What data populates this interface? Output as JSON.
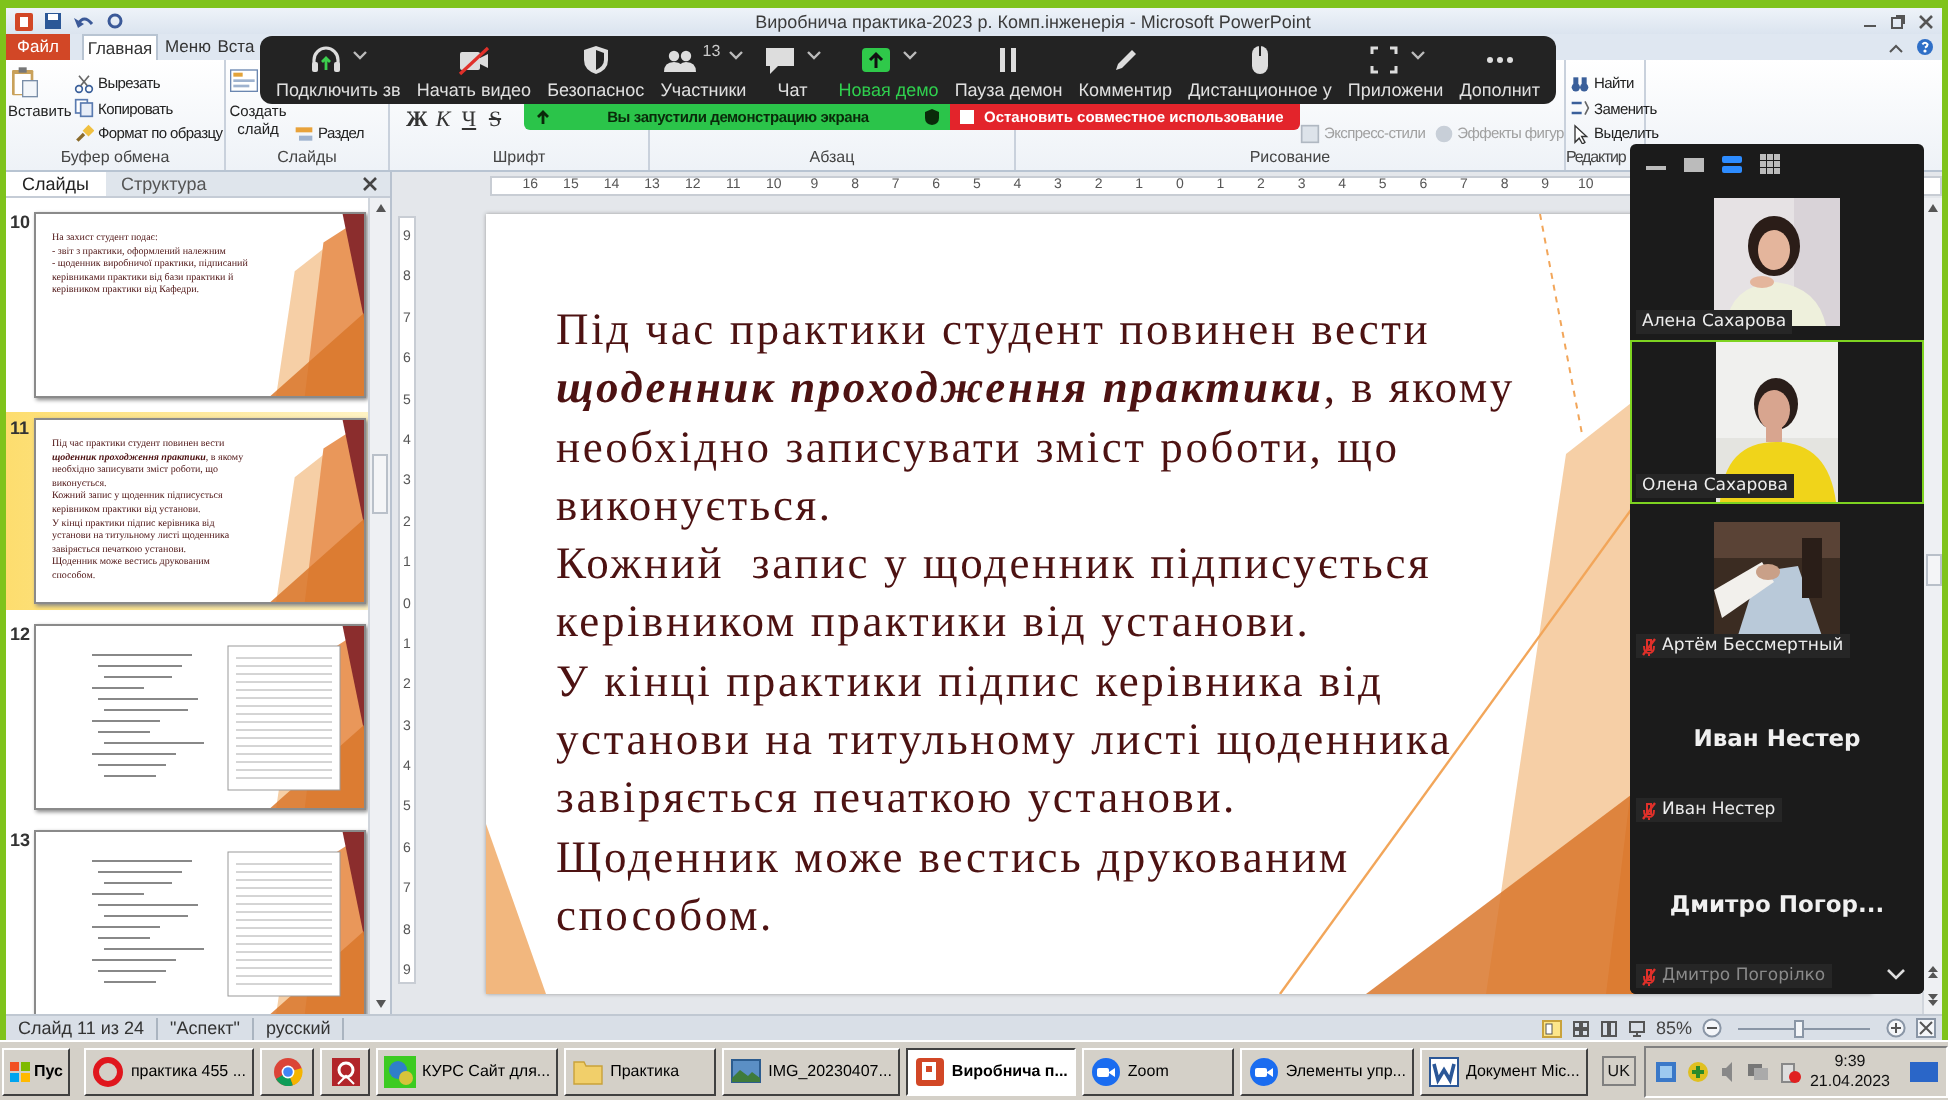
{
  "window": {
    "title": "Виробнича практика-2023 р. Комп.інженерія - Microsoft PowerPoint"
  },
  "ribbon_tabs": [
    {
      "label": "Файл",
      "kind": "file",
      "selected": false
    },
    {
      "label": "Главная",
      "kind": "tab",
      "selected": true
    },
    {
      "label": "Меню",
      "kind": "tab",
      "selected": false
    },
    {
      "label": "Вста",
      "kind": "tab",
      "selected": false
    }
  ],
  "ribbon_groups": [
    {
      "label": "Буфер обмена",
      "columns": [
        [
          {
            "label": "Вставить",
            "kind": "large",
            "disabled": false
          }
        ],
        [
          {
            "label": "Вырезать",
            "kind": "small",
            "disabled": false
          },
          {
            "label": "Копировать",
            "kind": "small",
            "disabled": false
          },
          {
            "label": "Формат по образцу",
            "kind": "small",
            "disabled": false
          }
        ]
      ]
    },
    {
      "label": "Слайды",
      "columns": [
        [
          {
            "label": "Создать слайд",
            "kind": "large",
            "disabled": false
          }
        ],
        [
          {
            "label": "Раздел",
            "kind": "small",
            "disabled": false
          }
        ]
      ]
    },
    {
      "label": "Шрифт",
      "columns": [
        [
          {
            "label": "Ж",
            "kind": "glyph",
            "disabled": false
          },
          {
            "label": "К",
            "kind": "glyph",
            "disabled": false
          },
          {
            "label": "Ч",
            "kind": "glyph",
            "disabled": false
          },
          {
            "label": "S",
            "kind": "glyph",
            "disabled": false
          }
        ]
      ]
    },
    {
      "label": "Абзац"
    },
    {
      "label": "Рисование",
      "columns": [
        [
          {
            "label": "Экспресс-стили",
            "kind": "small",
            "disabled": true
          }
        ],
        [
          {
            "label": "Эффекты фигур",
            "kind": "small",
            "disabled": true
          }
        ]
      ]
    },
    {
      "label": "Редактир",
      "columns": [
        [
          {
            "label": "Найти",
            "kind": "small",
            "disabled": false
          },
          {
            "label": "Заменить",
            "kind": "small",
            "disabled": false
          },
          {
            "label": "Выделить",
            "kind": "small",
            "disabled": false
          }
        ]
      ]
    }
  ],
  "slides_pane": {
    "tabs": [
      {
        "label": "Слайды",
        "selected": true
      },
      {
        "label": "Структура",
        "selected": false
      }
    ],
    "thumbnails": [
      {
        "number": "10",
        "kind": "text",
        "selected": false,
        "paragraphs": [
          "На захист студент подає:",
          "- звіт з практики, оформлений належним",
          "- щоденник виробничої практики, підписаний керівниками практики від бази практики й керівником практики від Кафедри."
        ]
      },
      {
        "number": "11",
        "kind": "text",
        "selected": true,
        "paragraphs": [
          "Під час практики студент повинен вести **щоденник проходження практики**, в якому необхідно записувати зміст роботи, що виконується.",
          "Кожний запис у щоденник підписується керівником практики від установи.",
          "У кінці практики підпис керівника від установи на титульному листі щоденника завіряється печаткою установи.",
          "Щоденник може вестись друкованим способом."
        ]
      },
      {
        "number": "12",
        "kind": "document",
        "selected": false
      },
      {
        "number": "13",
        "kind": "document",
        "selected": false
      }
    ]
  },
  "ruler": {
    "horizontal": [
      "16",
      "15",
      "14",
      "13",
      "12",
      "11",
      "10",
      "9",
      "8",
      "7",
      "6",
      "5",
      "4",
      "3",
      "2",
      "1",
      "0",
      "1",
      "2",
      "3",
      "4",
      "5",
      "6",
      "7",
      "8",
      "9",
      "10"
    ],
    "vertical": [
      "9",
      "8",
      "7",
      "6",
      "5",
      "4",
      "3",
      "2",
      "1",
      "0",
      "1",
      "2",
      "3",
      "4",
      "5",
      "6",
      "7",
      "8",
      "9"
    ]
  },
  "slide": {
    "paragraphs": [
      "Під час практики студент повинен вести **щоденник проходження практики**, в якому необхідно записувати зміст роботи, що виконується.",
      "Кожний  запис у щоденник підписується керівником практики від установи.",
      "У кінці практики підпис керівника від установи на титульному листі щоденника завіряється печаткою установи.",
      "Щоденник може вестись друкованим способом."
    ]
  },
  "status_bar": {
    "slide": "Слайд 11 из 24",
    "theme": "\"Аспект\"",
    "language": "русский",
    "zoom": "85%",
    "zoom_slider": {
      "level": 0.45
    }
  },
  "zoom_toolbar": {
    "items": [
      {
        "label": "Подключить зв",
        "kind": "button"
      },
      {
        "label": "Начать видео",
        "kind": "button"
      },
      {
        "label": "Безопаснос",
        "kind": "button"
      },
      {
        "label": "Участники",
        "kind": "button",
        "count": "13"
      },
      {
        "label": "Чат",
        "kind": "button"
      },
      {
        "label": "Новая демо",
        "kind": "share"
      },
      {
        "label": "Пауза демон",
        "kind": "button"
      },
      {
        "label": "Комментир",
        "kind": "button"
      },
      {
        "label": "Дистанционное у",
        "kind": "button"
      },
      {
        "label": "Приложени",
        "kind": "button"
      },
      {
        "label": "Дополнит",
        "kind": "button"
      }
    ]
  },
  "share_banner": {
    "message": "Вы запустили демонстрацию экрана",
    "stop": "Остановить совместное использование"
  },
  "gallery": {
    "views": [
      {
        "selected": false
      },
      {
        "selected": false
      },
      {
        "selected": true
      },
      {
        "selected": false
      }
    ],
    "tiles": [
      {
        "kind": "video",
        "name": "Алена Сахарова",
        "muted": false,
        "active": false
      },
      {
        "kind": "video",
        "name": "Олена Сахарова",
        "muted": false,
        "active": true
      },
      {
        "kind": "video",
        "name": "Артём Бессмертный",
        "muted": true,
        "active": false
      },
      {
        "kind": "name",
        "title": "Иван Нестер",
        "name": "Иван Нестер",
        "muted": true,
        "active": false
      },
      {
        "kind": "name",
        "title": "Дмитро Погор...",
        "name": "Дмитро Погорілко",
        "muted": true,
        "active": false
      }
    ]
  },
  "taskbar": {
    "start": "Пус",
    "items": [
      {
        "label": "практика 455 ...",
        "selected": false
      },
      {
        "selected": false
      },
      {
        "selected": false
      },
      {
        "label": "КУРС Сайт для...",
        "selected": false
      },
      {
        "label": "Практика",
        "selected": false
      },
      {
        "label": "IMG_20230407...",
        "selected": false
      },
      {
        "label": "Виробнича п...",
        "selected": true
      },
      {
        "label": "Zoom",
        "selected": false
      },
      {
        "label": "Элементы упр...",
        "selected": false
      },
      {
        "label": "Документ Mic...",
        "selected": false
      }
    ],
    "language": "UK",
    "time": "9:39",
    "date": "21.04.2023"
  }
}
